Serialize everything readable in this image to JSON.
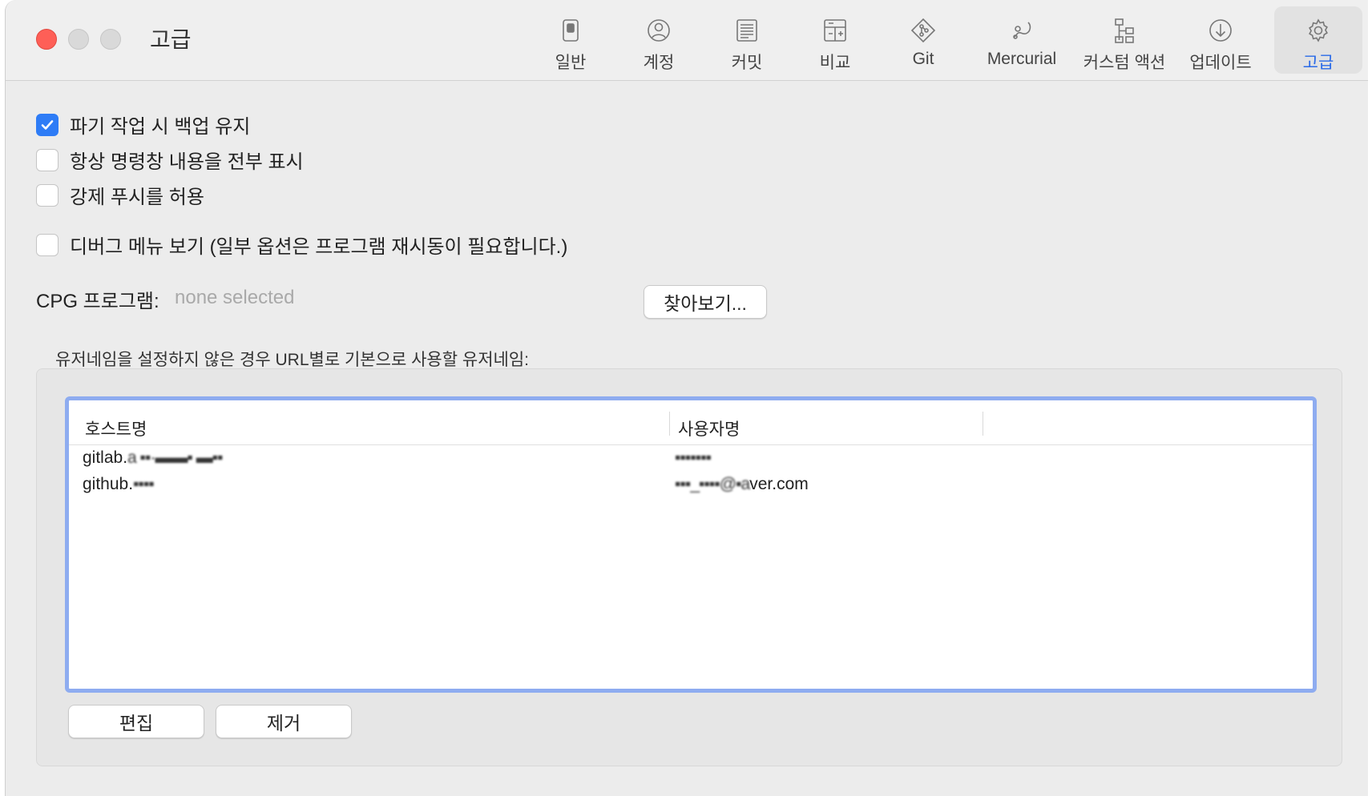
{
  "window": {
    "title": "고급"
  },
  "toolbar": {
    "items": [
      {
        "label": "일반",
        "icon": "general-switch-icon"
      },
      {
        "label": "계정",
        "icon": "account-person-icon"
      },
      {
        "label": "커밋",
        "icon": "commit-document-icon"
      },
      {
        "label": "비교",
        "icon": "diff-compare-icon"
      },
      {
        "label": "Git",
        "icon": "git-diamond-icon"
      },
      {
        "label": "Mercurial",
        "icon": "mercurial-icon"
      },
      {
        "label": "커스텀 액션",
        "icon": "custom-actions-tree-icon"
      },
      {
        "label": "업데이트",
        "icon": "update-download-icon"
      },
      {
        "label": "고급",
        "icon": "advanced-gear-icon",
        "active": true
      }
    ],
    "accent_color": "#2a6ae8"
  },
  "options": {
    "keep_backups": {
      "label": "파기 작업 시 백업 유지",
      "checked": true
    },
    "show_full_output": {
      "label": "항상 명령창 내용을 전부 표시",
      "checked": false
    },
    "allow_force_push": {
      "label": "강제 푸시를 허용",
      "checked": false
    },
    "debug_menu": {
      "label": "디버그 메뉴 보기 (일부 옵션은 프로그램 재시동이 필요합니다.)",
      "checked": false
    }
  },
  "gpg": {
    "label": "CPG 프로그램:",
    "value": "none selected",
    "browse_label": "찾아보기..."
  },
  "usernames": {
    "caption": "유저네임을 설정하지 않은 경우 URL별로 기본으로 사용할 유저네임:",
    "columns": [
      "호스트명",
      "사용자명"
    ],
    "rows": [
      {
        "host": "gitlab.",
        "host_blurred": "a ▪▪·▬▬▪ ▬▪▪",
        "user": "",
        "user_blurred": "▪▪▪▪▪▪▪"
      },
      {
        "host": "github.",
        "host_blurred": "▪▪▪▪",
        "user": "ver.com",
        "user_blurred": "▪▪▪_▪▪▪▪@▪a"
      }
    ],
    "edit_label": "편집",
    "remove_label": "제거"
  }
}
